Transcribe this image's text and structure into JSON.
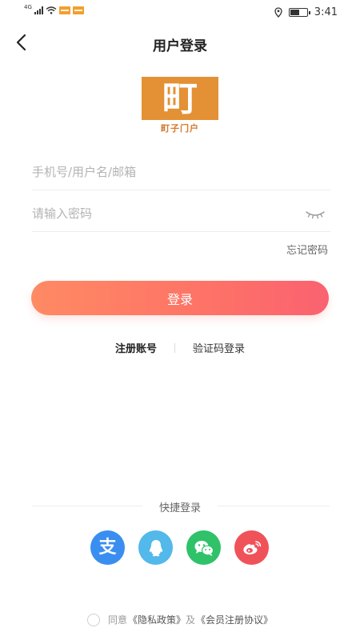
{
  "status_bar": {
    "network": "4G",
    "time": "3:41"
  },
  "header": {
    "title": "用户登录",
    "back_icon": "chevron-left-icon"
  },
  "logo": {
    "char": "町",
    "subtitle": "町子门户",
    "color": "#e39134"
  },
  "form": {
    "username_placeholder": "手机号/用户名/邮箱",
    "password_placeholder": "请输入密码",
    "password_toggle_icon": "eye-closed-icon",
    "forgot_label": "忘记密码",
    "login_label": "登录"
  },
  "links": {
    "register": "注册账号",
    "sms_login": "验证码登录"
  },
  "quick_login": {
    "title": "快捷登录",
    "providers": [
      {
        "icon": "alipay-icon",
        "color": "#3a8ef0"
      },
      {
        "icon": "qq-icon",
        "color": "#53b8ea"
      },
      {
        "icon": "wechat-icon",
        "color": "#2fc269"
      },
      {
        "icon": "weibo-icon",
        "color": "#f0525a"
      }
    ]
  },
  "agreement": {
    "prefix": "同意",
    "privacy": "《隐私政策》",
    "joiner": "及",
    "terms": "《会员注册协议》"
  },
  "colors": {
    "accent_start": "#ff8a64",
    "accent_end": "#fa6270"
  }
}
